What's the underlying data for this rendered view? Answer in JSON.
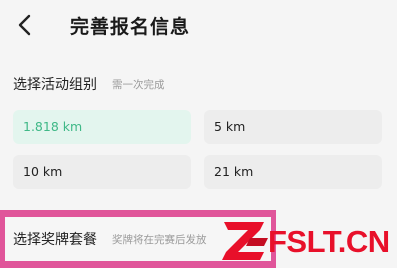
{
  "header": {
    "title": "完善报名信息"
  },
  "group_section": {
    "label": "选择活动组别",
    "hint": "需一次完成",
    "options": [
      {
        "label": "1.818 km",
        "selected": true
      },
      {
        "label": "5 km",
        "selected": false
      },
      {
        "label": "10 km",
        "selected": false
      },
      {
        "label": "21 km",
        "selected": false
      }
    ]
  },
  "medal_section": {
    "label": "选择奖牌套餐",
    "hint": "奖牌将在完赛后发放"
  },
  "watermark": {
    "text": "FSLT.CN"
  },
  "colors": {
    "selected_text": "#3fb887",
    "selected_bg": "#e3f5ee",
    "highlight": "#e0559a",
    "watermark": "#e8102a"
  }
}
